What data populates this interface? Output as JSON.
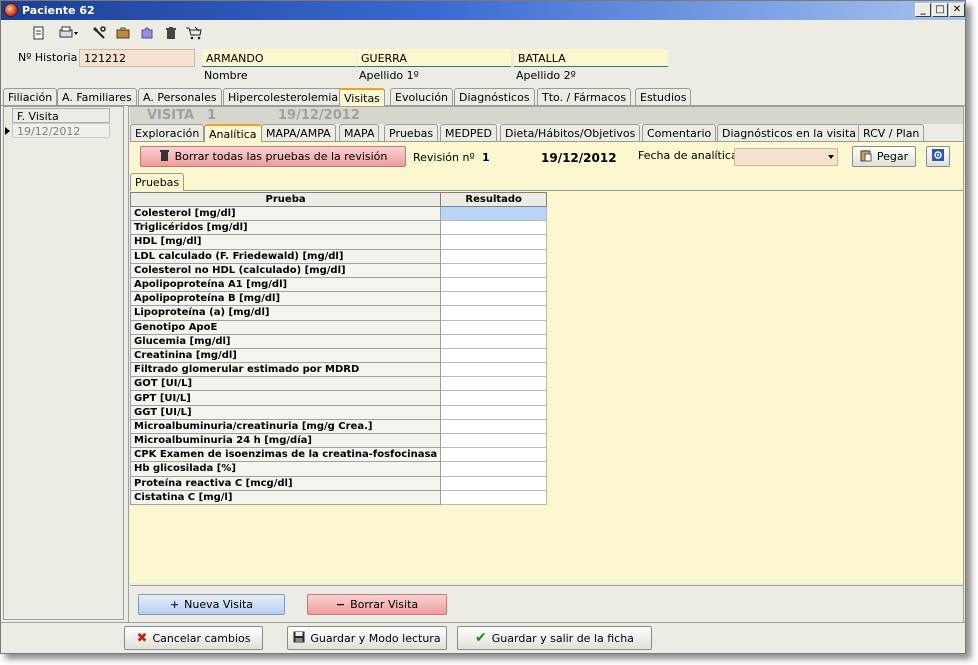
{
  "window": {
    "title": "Paciente 62"
  },
  "window_controls": {
    "minimize": "_",
    "maximize": "□",
    "close": "✕"
  },
  "header": {
    "historia_label": "Nº Historia",
    "historia_value": "121212",
    "nombre_value": "ARMANDO",
    "nombre_label": "Nombre",
    "apellido1_value": "GUERRA",
    "apellido1_label": "Apellido 1º",
    "apellido2_value": "BATALLA",
    "apellido2_label": "Apellido 2º"
  },
  "main_tabs": [
    "Filiación",
    "A. Familiares",
    "A. Personales",
    "Hipercolesterolemia",
    "Visitas",
    "Evolución",
    "Diagnósticos",
    "Tto. / Fármacos",
    "Estudios"
  ],
  "visit_list": {
    "header": "F. Visita",
    "rows": [
      "19/12/2012"
    ]
  },
  "visit_header": {
    "label": "VISITA",
    "number": "1",
    "date": "19/12/2012"
  },
  "sub_tabs": [
    "Exploración",
    "Analítica",
    "MAPA/AMPA",
    "MAPA",
    "Pruebas",
    "MEDPED",
    "Dieta/Hábitos/Objetivos",
    "Comentario",
    "Diagnósticos en la visita",
    "RCV / Plan"
  ],
  "analitica": {
    "delete_all_button": "Borrar todas las pruebas de la revisión",
    "revision_label": "Revisión nº",
    "revision_number": "1",
    "revision_date": "19/12/2012",
    "fecha_label": "Fecha de analítica",
    "fecha_value": "",
    "paste_button": "Pegar",
    "inner_tab": "Pruebas"
  },
  "tests_table": {
    "columns": [
      "Prueba",
      "Resultado"
    ],
    "rows": [
      "Colesterol [mg/dl]",
      "Triglicéridos [mg/dl]",
      "HDL [mg/dl]",
      "LDL calculado (F. Friedewald) [mg/dl]",
      "Colesterol no HDL (calculado) [mg/dl]",
      "Apolipoproteína A1 [mg/dl]",
      "Apolipoproteína B [mg/dl]",
      "Lipoproteína (a) [mg/dl]",
      "Genotipo ApoE",
      "Glucemia [mg/dl]",
      "Creatinina [mg/dl]",
      "Filtrado glomerular estimado por MDRD",
      "GOT [UI/L]",
      "GPT [UI/L]",
      "GGT [UI/L]",
      "Microalbuminuria/creatinuria [mg/g Crea.]",
      "Microalbuminuria 24 h [mg/día]",
      "CPK Examen de isoenzimas de la creatina-fosfocinasa",
      "Hb glicosilada [%]",
      "Proteína reactiva C [mcg/dl]",
      "Cistatina C [mg/l]"
    ]
  },
  "visit_buttons": {
    "new": "Nueva Visita",
    "delete": "Borrar Visita"
  },
  "footer": {
    "cancel": "Cancelar cambios",
    "save_read": "Guardar y Modo lectura",
    "save_exit": "Guardar y salir de la ficha"
  }
}
